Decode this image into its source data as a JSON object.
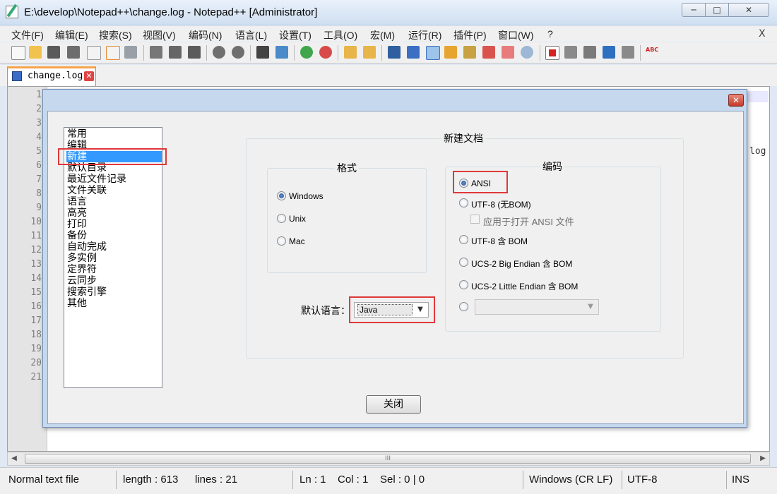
{
  "window": {
    "title": "E:\\develop\\Notepad++\\change.log - Notepad++ [Administrator]",
    "min_glyph": "─",
    "max_glyph": "□",
    "close_glyph": "✕"
  },
  "menu": {
    "items": [
      "文件(F)",
      "编辑(E)",
      "搜索(S)",
      "视图(V)",
      "编码(N)",
      "语言(L)",
      "设置(T)",
      "工具(O)",
      "宏(M)",
      "运行(R)",
      "插件(P)",
      "窗口(W)",
      "?"
    ],
    "close_glyph": "X"
  },
  "toolbar": {
    "icons": [
      "new-file-icon",
      "open-file-icon",
      "save-icon",
      "save-all-icon",
      "close-file-icon",
      "close-all-icon",
      "print-icon",
      "cut-icon",
      "copy-icon",
      "paste-icon",
      "undo-icon",
      "redo-icon",
      "find-icon",
      "replace-icon",
      "zoom-in-icon",
      "zoom-out-icon",
      "sync-vertical-icon",
      "sync-horizontal-icon",
      "word-wrap-icon",
      "show-all-chars-icon",
      "indent-guide-icon",
      "doc-map-icon",
      "function-list-icon",
      "folder-workspace-icon",
      "monitor-icon",
      "record-macro-icon",
      "stop-record-icon",
      "play-macro-icon",
      "run-macro-multiple-icon",
      "save-macro-icon",
      "spell-check-icon"
    ],
    "spell_label": "ABC"
  },
  "tab": {
    "label": "change.log",
    "close_glyph": "✕"
  },
  "editor": {
    "line_numbers": [
      "1",
      "2",
      "3",
      "4",
      "5",
      "6",
      "7",
      "8",
      "9",
      "10",
      "11",
      "12",
      "13",
      "14",
      "15",
      "16",
      "17",
      "18",
      "19",
      "20",
      "21"
    ],
    "visible_fragment": "log"
  },
  "scrollbar": {
    "left_glyph": "◀",
    "right_glyph": "▶",
    "thumb_glyph": "III"
  },
  "status": {
    "file_type": "Normal text file",
    "length": "length : 613",
    "lines": "lines : 21",
    "ln": "Ln : 1",
    "col": "Col : 1",
    "sel": "Sel : 0 | 0",
    "eol": "Windows (CR LF)",
    "encoding": "UTF-8",
    "mode": "INS"
  },
  "dialog": {
    "close_glyph": "✕",
    "categories": [
      "常用",
      "编辑",
      "新建",
      "默认目录",
      "最近文件记录",
      "文件关联",
      "语言",
      "高亮",
      "打印",
      "备份",
      "自动完成",
      "多实例",
      "定界符",
      "云同步",
      "搜索引擎",
      "其他"
    ],
    "selected_category": "新建",
    "new_doc_group_title": "新建文档",
    "format_group_title": "格式",
    "format_options": [
      "Windows",
      "Unix",
      "Mac"
    ],
    "format_selected": "Windows",
    "encoding_group_title": "编码",
    "encoding_options": {
      "ansi": "ANSI",
      "utf8_nobom": "UTF-8 (无BOM)",
      "apply_to_ansi": "应用于打开 ANSI 文件",
      "utf8_bom": "UTF-8 含 BOM",
      "ucs2_be": "UCS-2 Big Endian 含 BOM",
      "ucs2_le": "UCS-2 Little Endian 含 BOM",
      "other": ""
    },
    "encoding_selected": "ANSI",
    "default_language_label": "默认语言：",
    "default_language_value": "Java",
    "close_button_label": "关闭"
  },
  "colors": {
    "selection": "#3399ff",
    "highlight_box": "#e0383a",
    "tab_accent": "#f7a34b"
  }
}
